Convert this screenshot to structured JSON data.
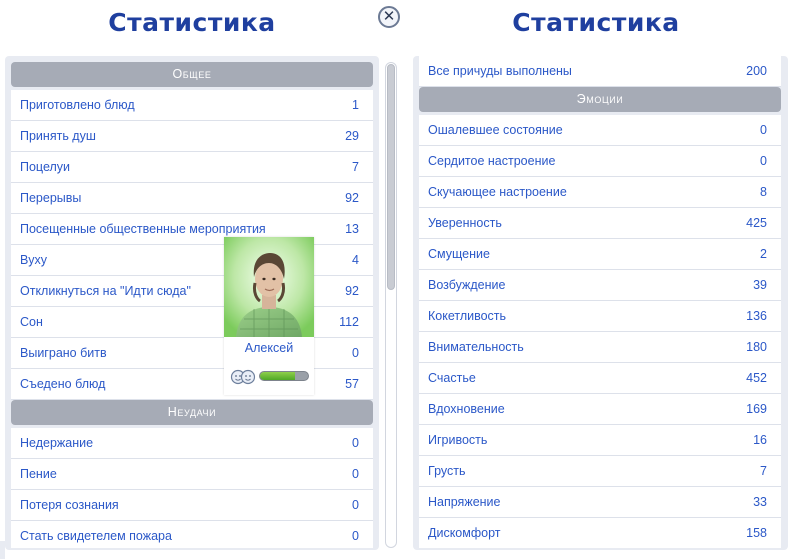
{
  "left": {
    "title": "Статистика",
    "sections": [
      {
        "header": "Общее",
        "rows": [
          {
            "label": "Приготовлено блюд",
            "value": "1"
          },
          {
            "label": "Принять душ",
            "value": "29"
          },
          {
            "label": "Поцелуи",
            "value": "7"
          },
          {
            "label": "Перерывы",
            "value": "92"
          },
          {
            "label": "Посещенные общественные мероприятия",
            "value": "13"
          },
          {
            "label": "Вуху",
            "value": "4"
          },
          {
            "label": "Откликнуться на \"Идти сюда\"",
            "value": "92"
          },
          {
            "label": "Сон",
            "value": "112"
          },
          {
            "label": "Выиграно битв",
            "value": "0"
          },
          {
            "label": "Съедено блюд",
            "value": "57"
          }
        ]
      },
      {
        "header": "Неудачи",
        "rows": [
          {
            "label": "Недержание",
            "value": "0"
          },
          {
            "label": "Пение",
            "value": "0"
          },
          {
            "label": "Потеря сознания",
            "value": "0"
          },
          {
            "label": "Стать свидетелем пожара",
            "value": "0"
          }
        ]
      }
    ]
  },
  "right": {
    "title": "Статистика",
    "sections": [
      {
        "header": "",
        "rows": [
          {
            "label": "Все причуды выполнены",
            "value": "200"
          }
        ]
      },
      {
        "header": "Эмоции",
        "rows": [
          {
            "label": "Ошалевшее состояние",
            "value": "0"
          },
          {
            "label": "Сердитое настроение",
            "value": "0"
          },
          {
            "label": "Скучающее настроение",
            "value": "8"
          },
          {
            "label": "Уверенность",
            "value": "425"
          },
          {
            "label": "Смущение",
            "value": "2"
          },
          {
            "label": "Возбуждение",
            "value": "39"
          },
          {
            "label": "Кокетливость",
            "value": "136"
          },
          {
            "label": "Внимательность",
            "value": "180"
          },
          {
            "label": "Счастье",
            "value": "452"
          },
          {
            "label": "Вдохновение",
            "value": "169"
          },
          {
            "label": "Игривость",
            "value": "16"
          },
          {
            "label": "Грусть",
            "value": "7"
          },
          {
            "label": "Напряжение",
            "value": "33"
          },
          {
            "label": "Дискомфорт",
            "value": "158"
          }
        ]
      }
    ]
  },
  "sim": {
    "name": "Алексей",
    "mood_icon": "happy-faces-icon",
    "mood_level": 0.72,
    "mood_color": "#6abf3a"
  },
  "close_icon": "close-icon",
  "colors": {
    "accent": "#1f3f9f",
    "text": "#2b58c8",
    "header_bg": "#a6abb6"
  }
}
